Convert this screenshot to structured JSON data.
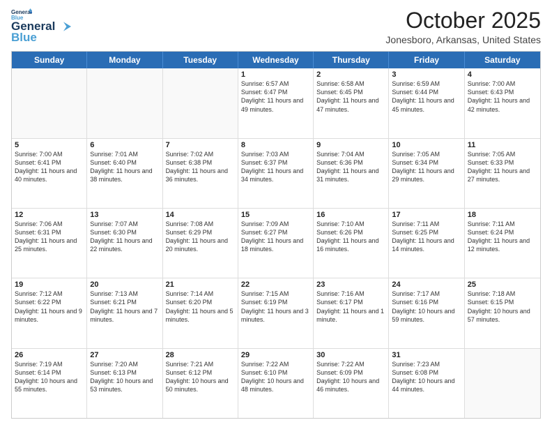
{
  "logo": {
    "line1": "General",
    "line2": "Blue"
  },
  "header": {
    "month": "October 2025",
    "location": "Jonesboro, Arkansas, United States"
  },
  "weekdays": [
    "Sunday",
    "Monday",
    "Tuesday",
    "Wednesday",
    "Thursday",
    "Friday",
    "Saturday"
  ],
  "rows": [
    [
      {
        "day": "",
        "info": ""
      },
      {
        "day": "",
        "info": ""
      },
      {
        "day": "",
        "info": ""
      },
      {
        "day": "1",
        "info": "Sunrise: 6:57 AM\nSunset: 6:47 PM\nDaylight: 11 hours and 49 minutes."
      },
      {
        "day": "2",
        "info": "Sunrise: 6:58 AM\nSunset: 6:45 PM\nDaylight: 11 hours and 47 minutes."
      },
      {
        "day": "3",
        "info": "Sunrise: 6:59 AM\nSunset: 6:44 PM\nDaylight: 11 hours and 45 minutes."
      },
      {
        "day": "4",
        "info": "Sunrise: 7:00 AM\nSunset: 6:43 PM\nDaylight: 11 hours and 42 minutes."
      }
    ],
    [
      {
        "day": "5",
        "info": "Sunrise: 7:00 AM\nSunset: 6:41 PM\nDaylight: 11 hours and 40 minutes."
      },
      {
        "day": "6",
        "info": "Sunrise: 7:01 AM\nSunset: 6:40 PM\nDaylight: 11 hours and 38 minutes."
      },
      {
        "day": "7",
        "info": "Sunrise: 7:02 AM\nSunset: 6:38 PM\nDaylight: 11 hours and 36 minutes."
      },
      {
        "day": "8",
        "info": "Sunrise: 7:03 AM\nSunset: 6:37 PM\nDaylight: 11 hours and 34 minutes."
      },
      {
        "day": "9",
        "info": "Sunrise: 7:04 AM\nSunset: 6:36 PM\nDaylight: 11 hours and 31 minutes."
      },
      {
        "day": "10",
        "info": "Sunrise: 7:05 AM\nSunset: 6:34 PM\nDaylight: 11 hours and 29 minutes."
      },
      {
        "day": "11",
        "info": "Sunrise: 7:05 AM\nSunset: 6:33 PM\nDaylight: 11 hours and 27 minutes."
      }
    ],
    [
      {
        "day": "12",
        "info": "Sunrise: 7:06 AM\nSunset: 6:31 PM\nDaylight: 11 hours and 25 minutes."
      },
      {
        "day": "13",
        "info": "Sunrise: 7:07 AM\nSunset: 6:30 PM\nDaylight: 11 hours and 22 minutes."
      },
      {
        "day": "14",
        "info": "Sunrise: 7:08 AM\nSunset: 6:29 PM\nDaylight: 11 hours and 20 minutes."
      },
      {
        "day": "15",
        "info": "Sunrise: 7:09 AM\nSunset: 6:27 PM\nDaylight: 11 hours and 18 minutes."
      },
      {
        "day": "16",
        "info": "Sunrise: 7:10 AM\nSunset: 6:26 PM\nDaylight: 11 hours and 16 minutes."
      },
      {
        "day": "17",
        "info": "Sunrise: 7:11 AM\nSunset: 6:25 PM\nDaylight: 11 hours and 14 minutes."
      },
      {
        "day": "18",
        "info": "Sunrise: 7:11 AM\nSunset: 6:24 PM\nDaylight: 11 hours and 12 minutes."
      }
    ],
    [
      {
        "day": "19",
        "info": "Sunrise: 7:12 AM\nSunset: 6:22 PM\nDaylight: 11 hours and 9 minutes."
      },
      {
        "day": "20",
        "info": "Sunrise: 7:13 AM\nSunset: 6:21 PM\nDaylight: 11 hours and 7 minutes."
      },
      {
        "day": "21",
        "info": "Sunrise: 7:14 AM\nSunset: 6:20 PM\nDaylight: 11 hours and 5 minutes."
      },
      {
        "day": "22",
        "info": "Sunrise: 7:15 AM\nSunset: 6:19 PM\nDaylight: 11 hours and 3 minutes."
      },
      {
        "day": "23",
        "info": "Sunrise: 7:16 AM\nSunset: 6:17 PM\nDaylight: 11 hours and 1 minute."
      },
      {
        "day": "24",
        "info": "Sunrise: 7:17 AM\nSunset: 6:16 PM\nDaylight: 10 hours and 59 minutes."
      },
      {
        "day": "25",
        "info": "Sunrise: 7:18 AM\nSunset: 6:15 PM\nDaylight: 10 hours and 57 minutes."
      }
    ],
    [
      {
        "day": "26",
        "info": "Sunrise: 7:19 AM\nSunset: 6:14 PM\nDaylight: 10 hours and 55 minutes."
      },
      {
        "day": "27",
        "info": "Sunrise: 7:20 AM\nSunset: 6:13 PM\nDaylight: 10 hours and 53 minutes."
      },
      {
        "day": "28",
        "info": "Sunrise: 7:21 AM\nSunset: 6:12 PM\nDaylight: 10 hours and 50 minutes."
      },
      {
        "day": "29",
        "info": "Sunrise: 7:22 AM\nSunset: 6:10 PM\nDaylight: 10 hours and 48 minutes."
      },
      {
        "day": "30",
        "info": "Sunrise: 7:22 AM\nSunset: 6:09 PM\nDaylight: 10 hours and 46 minutes."
      },
      {
        "day": "31",
        "info": "Sunrise: 7:23 AM\nSunset: 6:08 PM\nDaylight: 10 hours and 44 minutes."
      },
      {
        "day": "",
        "info": ""
      }
    ]
  ]
}
